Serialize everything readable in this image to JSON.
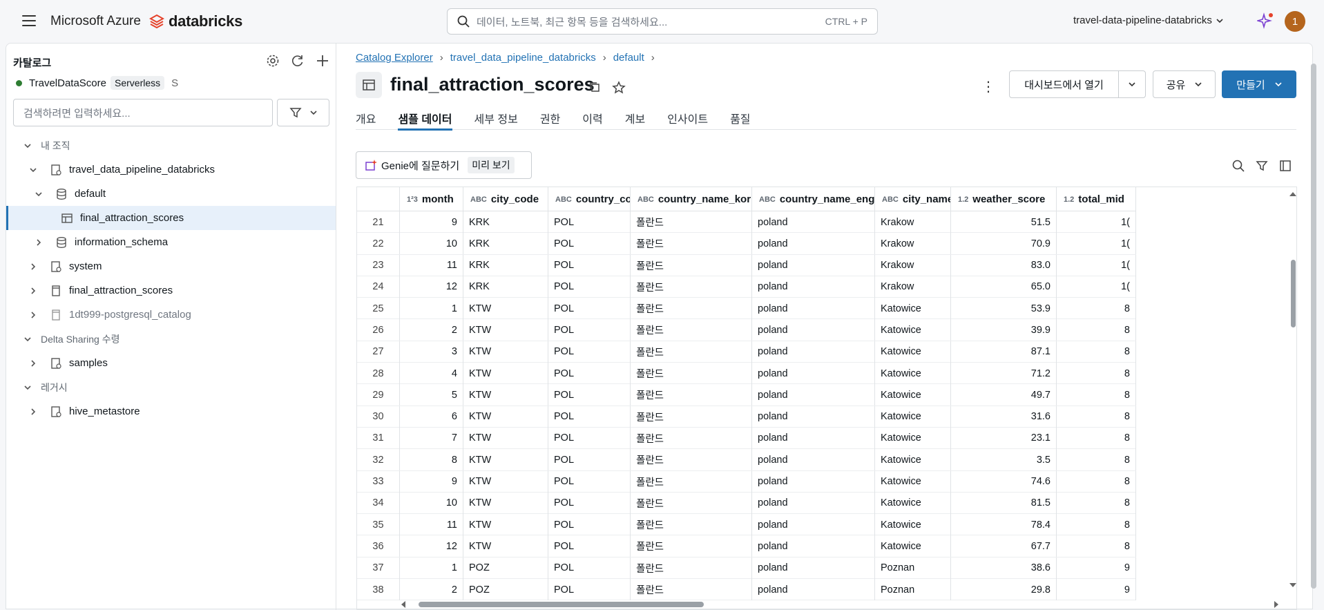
{
  "topbar": {
    "brand_ms": "Microsoft Azure",
    "brand_db": "databricks",
    "search_placeholder": "데이터, 노트북, 최근 항목 등을 검색하세요...",
    "search_shortcut": "CTRL + P",
    "workspace": "travel-data-pipeline-databricks",
    "avatar_initial": "1"
  },
  "sidebar": {
    "title": "카탈로그",
    "compute_name": "TravelDataScore",
    "compute_type": "Serverless",
    "compute_extra": "S",
    "search_placeholder": "검색하려면 입력하세요...",
    "tree": [
      {
        "label": "내 조직",
        "level": 0,
        "kind": "section",
        "expanded": true
      },
      {
        "label": "travel_data_pipeline_databricks",
        "level": 1,
        "kind": "catalog",
        "expanded": true
      },
      {
        "label": "default",
        "level": 2,
        "kind": "schema",
        "expanded": true
      },
      {
        "label": "final_attraction_scores",
        "level": 3,
        "kind": "table",
        "selected": true
      },
      {
        "label": "information_schema",
        "level": 2,
        "kind": "schema",
        "expanded": false
      },
      {
        "label": "system",
        "level": 1,
        "kind": "catalog",
        "expanded": false
      },
      {
        "label": "final_attraction_scores",
        "level": 1,
        "kind": "foreign",
        "expanded": false
      },
      {
        "label": "1dt999-postgresql_catalog",
        "level": 1,
        "kind": "foreign-muted",
        "expanded": false
      },
      {
        "label": "Delta Sharing 수령",
        "level": 0,
        "kind": "section",
        "expanded": true
      },
      {
        "label": "samples",
        "level": 1,
        "kind": "shared",
        "expanded": false
      },
      {
        "label": "레거시",
        "level": 0,
        "kind": "section",
        "expanded": true
      },
      {
        "label": "hive_metastore",
        "level": 1,
        "kind": "catalog",
        "expanded": false
      }
    ]
  },
  "main": {
    "breadcrumb": [
      "Catalog Explorer",
      "travel_data_pipeline_databricks",
      "default"
    ],
    "title": "final_attraction_scores",
    "btn_dashboard": "대시보드에서 열기",
    "btn_share": "공유",
    "btn_create": "만들기",
    "tabs": [
      "개요",
      "샘플 데이터",
      "세부 정보",
      "권한",
      "이력",
      "계보",
      "인사이트",
      "품질"
    ],
    "active_tab": 1,
    "genie_label": "Genie에 질문하기",
    "genie_badge": "미리 보기"
  },
  "table": {
    "columns": [
      {
        "name": "",
        "type": ""
      },
      {
        "name": "month",
        "type": "1²3"
      },
      {
        "name": "city_code",
        "type": "ABC"
      },
      {
        "name": "country_code",
        "type": "ABC"
      },
      {
        "name": "country_name_kor",
        "type": "ABC"
      },
      {
        "name": "country_name_eng",
        "type": "ABC"
      },
      {
        "name": "city_name_...",
        "type": "ABC"
      },
      {
        "name": "weather_score",
        "type": "1.2"
      },
      {
        "name": "total_mid",
        "type": "1.2"
      }
    ],
    "rows": [
      [
        "21",
        "9",
        "KRK",
        "POL",
        "폴란드",
        "poland",
        "Krakow",
        "51.5",
        "1("
      ],
      [
        "22",
        "10",
        "KRK",
        "POL",
        "폴란드",
        "poland",
        "Krakow",
        "70.9",
        "1("
      ],
      [
        "23",
        "11",
        "KRK",
        "POL",
        "폴란드",
        "poland",
        "Krakow",
        "83.0",
        "1("
      ],
      [
        "24",
        "12",
        "KRK",
        "POL",
        "폴란드",
        "poland",
        "Krakow",
        "65.0",
        "1("
      ],
      [
        "25",
        "1",
        "KTW",
        "POL",
        "폴란드",
        "poland",
        "Katowice",
        "53.9",
        "8"
      ],
      [
        "26",
        "2",
        "KTW",
        "POL",
        "폴란드",
        "poland",
        "Katowice",
        "39.9",
        "8"
      ],
      [
        "27",
        "3",
        "KTW",
        "POL",
        "폴란드",
        "poland",
        "Katowice",
        "87.1",
        "8"
      ],
      [
        "28",
        "4",
        "KTW",
        "POL",
        "폴란드",
        "poland",
        "Katowice",
        "71.2",
        "8"
      ],
      [
        "29",
        "5",
        "KTW",
        "POL",
        "폴란드",
        "poland",
        "Katowice",
        "49.7",
        "8"
      ],
      [
        "30",
        "6",
        "KTW",
        "POL",
        "폴란드",
        "poland",
        "Katowice",
        "31.6",
        "8"
      ],
      [
        "31",
        "7",
        "KTW",
        "POL",
        "폴란드",
        "poland",
        "Katowice",
        "23.1",
        "8"
      ],
      [
        "32",
        "8",
        "KTW",
        "POL",
        "폴란드",
        "poland",
        "Katowice",
        "3.5",
        "8"
      ],
      [
        "33",
        "9",
        "KTW",
        "POL",
        "폴란드",
        "poland",
        "Katowice",
        "74.6",
        "8"
      ],
      [
        "34",
        "10",
        "KTW",
        "POL",
        "폴란드",
        "poland",
        "Katowice",
        "81.5",
        "8"
      ],
      [
        "35",
        "11",
        "KTW",
        "POL",
        "폴란드",
        "poland",
        "Katowice",
        "78.4",
        "8"
      ],
      [
        "36",
        "12",
        "KTW",
        "POL",
        "폴란드",
        "poland",
        "Katowice",
        "67.7",
        "8"
      ],
      [
        "37",
        "1",
        "POZ",
        "POL",
        "폴란드",
        "poland",
        "Poznan",
        "38.6",
        "9"
      ],
      [
        "38",
        "2",
        "POZ",
        "POL",
        "폴란드",
        "poland",
        "Poznan",
        "29.8",
        "9"
      ]
    ]
  },
  "colors": {
    "accent": "#2272b4",
    "brand_red": "#e5422b",
    "compute_online": "#2e7d32",
    "avatar": "#b5651d"
  }
}
